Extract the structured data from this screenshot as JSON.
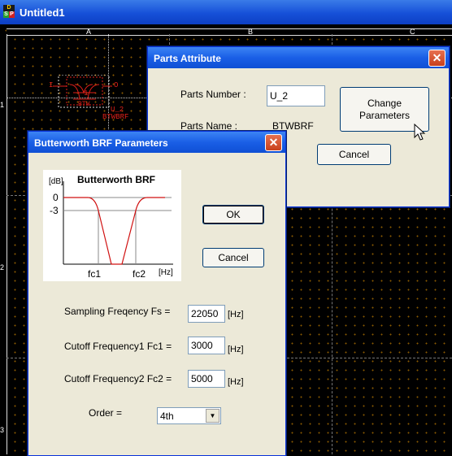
{
  "main_window": {
    "title": "Untitled1",
    "app_icon_letters": [
      "D",
      "S",
      "P"
    ]
  },
  "sheet": {
    "columns": [
      "A",
      "B",
      "C"
    ],
    "rows": [
      "1",
      "2",
      "3"
    ],
    "part_label_in": "I",
    "part_label_out": "O",
    "part_label_mid": "1",
    "part_ref": "U_2",
    "part_name": "BTWBRF",
    "grid_color": "#8a5a00",
    "part_color": "#e0201a"
  },
  "parts_attribute": {
    "title": "Parts Attribute",
    "parts_number_label": "Parts Number :",
    "parts_number_value": "U_2",
    "parts_name_label": "Parts Name :",
    "parts_name_value": "BTWBRF",
    "change_button": "Change\nParameters",
    "cancel_button": "Cancel"
  },
  "brf_params": {
    "title": "Butterworth BRF Parameters",
    "graph": {
      "title": "Butterworth BRF",
      "ylabel": "[dB]",
      "ytick_0": "0",
      "ytick_3": "-3",
      "xtick_fc1": "fc1",
      "xtick_fc2": "fc2",
      "xunit": "[Hz]"
    },
    "ok_button": "OK",
    "cancel_button": "Cancel",
    "sampling_label": "Sampling Freqency Fs =",
    "sampling_value": "22050",
    "cutoff1_label": "Cutoff Frequency1 Fc1 =",
    "cutoff1_value": "3000",
    "cutoff2_label": "Cutoff Frequency2 Fc2 =",
    "cutoff2_value": "5000",
    "unit": "[Hz]",
    "order_label": "Order =",
    "order_value": "4th"
  }
}
